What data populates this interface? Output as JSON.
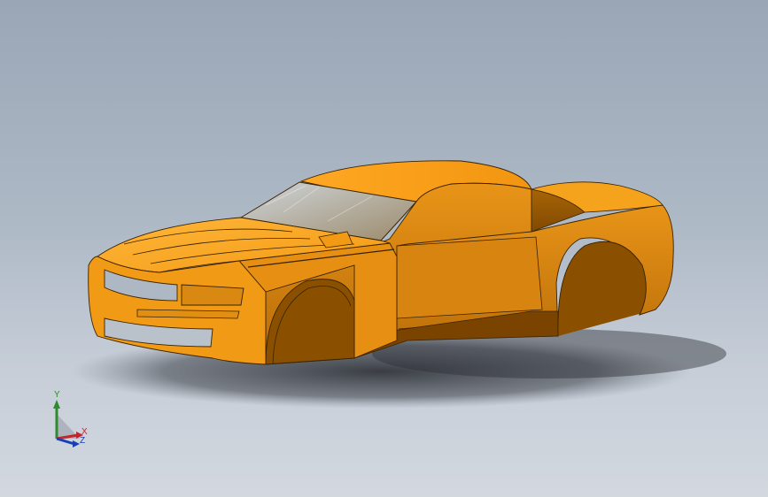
{
  "viewport": {
    "background_top": "#9aa6b6",
    "background_bottom": "#d3d8df"
  },
  "model": {
    "body_color": "#f0a020",
    "body_shadow_color": "#8a5600",
    "glass_color": "#b8c2c8"
  },
  "triad": {
    "x_label": "X",
    "y_label": "Y",
    "z_label": "Z",
    "x_color": "#c0262c",
    "y_color": "#2e8b2e",
    "z_color": "#1a3fb5"
  }
}
